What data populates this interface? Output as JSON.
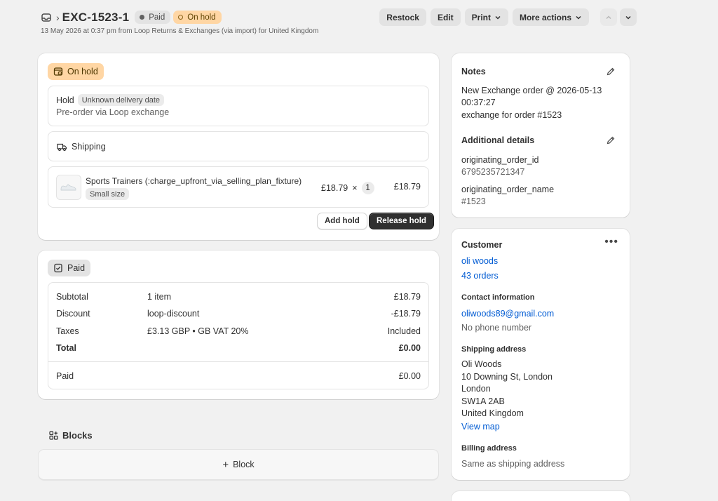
{
  "header": {
    "order_id": "EXC-1523-1",
    "paid_badge": "Paid",
    "hold_badge": "On hold",
    "subtitle": "13 May 2026 at 0:37 pm from Loop Returns & Exchanges (via import) for United Kingdom",
    "actions": [
      "Restock",
      "Edit",
      "Print",
      "More actions"
    ]
  },
  "hold_card": {
    "status": "On hold",
    "hold_label": "Hold",
    "hold_tag": "Unknown delivery date",
    "hold_note": "Pre-order via Loop exchange",
    "shipping_label": "Shipping",
    "product": {
      "name": "Sports Trainers (:charge_upfront_via_selling_plan_fixture)",
      "variant": "Small size",
      "price": "£18.79",
      "times": "×",
      "qty": "1",
      "total": "£18.79"
    },
    "add_hold": "Add hold",
    "release_hold": "Release hold"
  },
  "paid_card": {
    "status": "Paid",
    "rows": [
      {
        "label": "Subtotal",
        "mid": "1 item",
        "value": "£18.79"
      },
      {
        "label": "Discount",
        "mid": "loop-discount",
        "value": "-£18.79"
      },
      {
        "label": "Taxes",
        "mid": "£3.13 GBP • GB VAT 20%",
        "value": "Included"
      },
      {
        "label": "Total",
        "mid": "",
        "value": "£0.00"
      }
    ],
    "paid_label": "Paid",
    "paid_value": "£0.00"
  },
  "blocks": {
    "title": "Blocks",
    "add_label": "Block"
  },
  "notes": {
    "title": "Notes",
    "line1": "New Exchange order @ 2026-05-13",
    "line2": "00:37:27",
    "line3": "exchange for order #1523",
    "additional_title": "Additional details",
    "k1": "originating_order_id",
    "v1": "6795235721347",
    "k2": "originating_order_name",
    "v2": "#1523"
  },
  "customer": {
    "title": "Customer",
    "name": "oli woods",
    "orders": "43 orders",
    "contact_title": "Contact information",
    "email": "oliwoods89@gmail.com",
    "phone": "No phone number",
    "shipping_title": "Shipping address",
    "address": [
      "Oli Woods",
      "10 Downing St, London",
      "London",
      "SW1A 2AB",
      "United Kingdom"
    ],
    "view_map": "View map",
    "billing_title": "Billing address",
    "billing": "Same as shipping address"
  },
  "colors": {
    "hold_bg": "#ffd6a4",
    "link": "#005bd3",
    "primary_button": "#303030"
  }
}
